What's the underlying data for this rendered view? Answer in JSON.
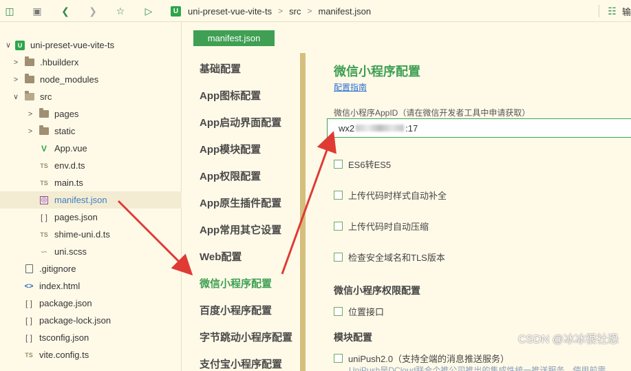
{
  "toolbar": {
    "breadcrumb": [
      "uni-preset-vue-vite-ts",
      "src",
      "manifest.json"
    ],
    "right_label": "输"
  },
  "sidebar": {
    "items": [
      {
        "label": "uni-preset-vue-vite-ts",
        "icon": "project-logo-icon",
        "chevron": "down"
      },
      {
        "label": ".hbuilderx",
        "icon": "folder-icon",
        "chevron": "right"
      },
      {
        "label": "node_modules",
        "icon": "folder-icon",
        "chevron": "right"
      },
      {
        "label": "src",
        "icon": "folder-open-icon",
        "chevron": "down"
      },
      {
        "label": "pages",
        "icon": "folder-icon",
        "chevron": "right"
      },
      {
        "label": "static",
        "icon": "folder-icon",
        "chevron": "right"
      },
      {
        "label": "App.vue",
        "icon": "vue-file-icon",
        "chevron": ""
      },
      {
        "label": "env.d.ts",
        "icon": "ts-file-icon",
        "chevron": ""
      },
      {
        "label": "main.ts",
        "icon": "ts-file-icon",
        "chevron": ""
      },
      {
        "label": "manifest.json",
        "icon": "json-config-icon",
        "chevron": ""
      },
      {
        "label": "pages.json",
        "icon": "json-file-icon",
        "chevron": ""
      },
      {
        "label": "shime-uni.d.ts",
        "icon": "ts-file-icon",
        "chevron": ""
      },
      {
        "label": "uni.scss",
        "icon": "scss-file-icon",
        "chevron": ""
      },
      {
        "label": ".gitignore",
        "icon": "file-icon",
        "chevron": ""
      },
      {
        "label": "index.html",
        "icon": "html-file-icon",
        "chevron": ""
      },
      {
        "label": "package.json",
        "icon": "json-file-icon",
        "chevron": ""
      },
      {
        "label": "package-lock.json",
        "icon": "json-file-icon",
        "chevron": ""
      },
      {
        "label": "tsconfig.json",
        "icon": "json-file-icon",
        "chevron": ""
      },
      {
        "label": "vite.config.ts",
        "icon": "ts-file-icon",
        "chevron": ""
      }
    ]
  },
  "editor": {
    "tab_label": "manifest.json",
    "nav": [
      "基础配置",
      "App图标配置",
      "App启动界面配置",
      "App模块配置",
      "App权限配置",
      "App原生插件配置",
      "App常用其它设置",
      "Web配置",
      "微信小程序配置",
      "百度小程序配置",
      "字节跳动小程序配置",
      "支付宝小程序配置"
    ],
    "active_nav": "微信小程序配置",
    "title": "微信小程序配置",
    "guide_link": "配置指南",
    "appid_label": "微信小程序AppID（请在微信开发者工具中申请获取）",
    "appid_prefix": "wx2",
    "appid_suffix": ":17",
    "options": [
      "ES6转ES5",
      "上传代码时样式自动补全",
      "上传代码时自动压缩",
      "检查安全域名和TLS版本"
    ],
    "permissions_heading": "微信小程序权限配置",
    "permissions": [
      "位置接口"
    ],
    "modules_heading": "模块配置",
    "modules": [
      "uniPush2.0（支持全端的消息推送服务）"
    ],
    "faded_line": "UniPush是DCloud联合个推公司推出的集成性统一推送服务，使用前需",
    "watermark": "CSDN @冰冰很社恐"
  },
  "colors": {
    "accent": "#3f9f53",
    "background": "#fffae8",
    "arrow": "#e03a35",
    "link": "#2a6fd1"
  }
}
